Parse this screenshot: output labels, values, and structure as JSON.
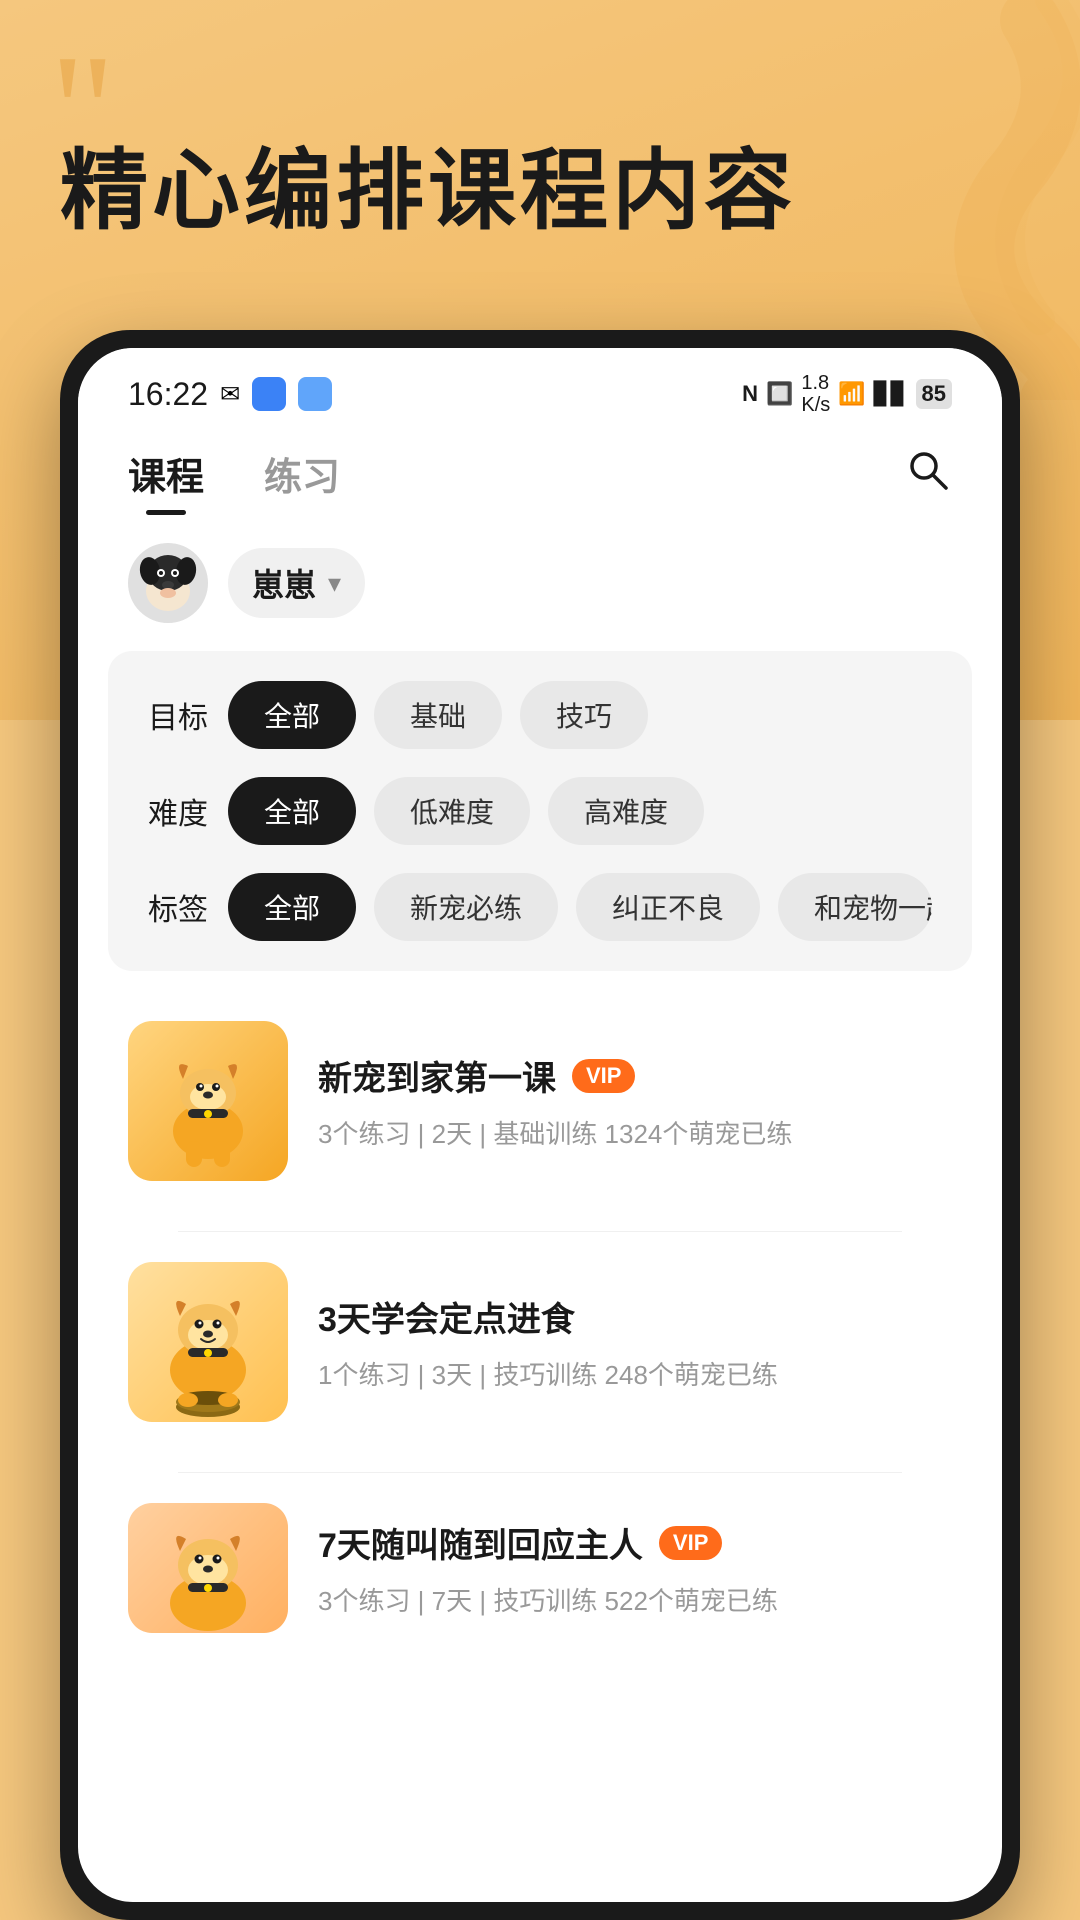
{
  "background": {
    "headline": "精心编排课程内容",
    "quote_char": "“"
  },
  "status_bar": {
    "time": "16:22",
    "battery": "85",
    "signal_info": "1.8\nK/s"
  },
  "nav": {
    "tab1_label": "课程",
    "tab2_label": "练习",
    "search_label": "搜索"
  },
  "pet_selector": {
    "name": "崽崽",
    "dropdown_label": "切换宠物"
  },
  "filters": {
    "goal_label": "目标",
    "goal_chips": [
      {
        "label": "全部",
        "active": true
      },
      {
        "label": "基础",
        "active": false
      },
      {
        "label": "技巧",
        "active": false
      }
    ],
    "difficulty_label": "难度",
    "difficulty_chips": [
      {
        "label": "全部",
        "active": true
      },
      {
        "label": "低难度",
        "active": false
      },
      {
        "label": "高难度",
        "active": false
      }
    ],
    "tag_label": "标签",
    "tag_chips": [
      {
        "label": "全部",
        "active": true
      },
      {
        "label": "新宠必练",
        "active": false
      },
      {
        "label": "纠正不良",
        "active": false
      },
      {
        "label": "和宠物一起",
        "active": false
      }
    ]
  },
  "courses": [
    {
      "title": "新宠到家第一课",
      "vip": true,
      "meta": "3个练习 | 2天 | 基础训练    1324个萌宠已练"
    },
    {
      "title": "3天学会定点进食",
      "vip": false,
      "meta": "1个练习 | 3天 | 技巧训练    248个萌宠已练"
    },
    {
      "title": "7天随叫随到回应主人",
      "vip": true,
      "meta": "3个练习 | 7天 | 技巧训练    522个萌宠已练"
    }
  ]
}
